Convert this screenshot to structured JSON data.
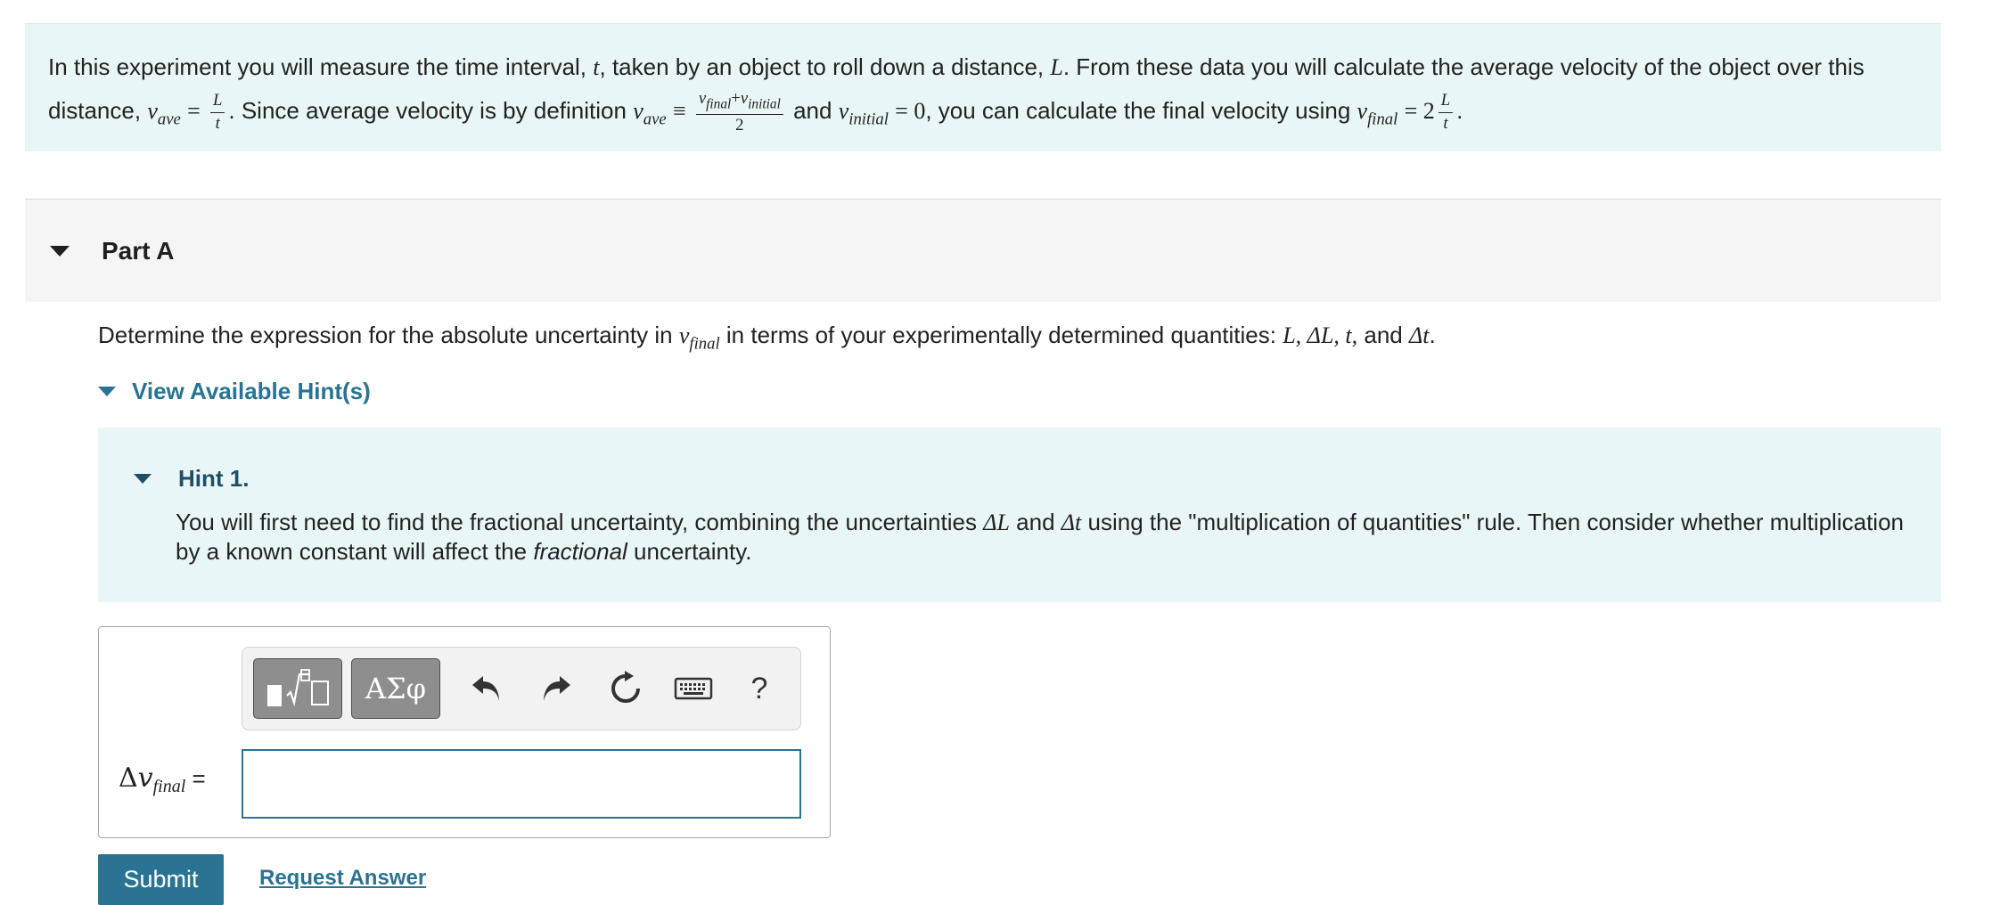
{
  "intro": {
    "s1": "In this experiment you will measure the time interval,",
    "var_t": "t",
    "s2": ", taken by an object to roll down a distance,",
    "var_L": "L",
    "s3": ". From these data you will calculate the average velocity of the object over this",
    "s4": "distance,",
    "v": "v",
    "sub_ave": "ave",
    "eq": "=",
    "s5": ". Since average velocity is by definition",
    "equiv": "≡",
    "sub_final": "final",
    "plus": "+",
    "sub_initial": "initial",
    "two": "2",
    "s6": "and",
    "zero": "= 0",
    "s7": ", you can calculate the final velocity using",
    "eq2": "= 2",
    "period": "."
  },
  "part": {
    "title": "Part A"
  },
  "question": {
    "s1": "Determine the expression for the absolute uncertainty in",
    "v": "v",
    "sub_final": "final",
    "s2": "in terms of your experimentally determined quantities:",
    "quantities": "L, ΔL, t,",
    "s3": "and",
    "dt": "Δt",
    "period": "."
  },
  "hints": {
    "toggle_label": "View Available Hint(s)",
    "hint1": {
      "title": "Hint 1.",
      "s1": "You will first need to find the fractional uncertainty, combining the uncertainties",
      "dL": "ΔL",
      "and": "and",
      "dt": "Δt",
      "s2": "using the \"multiplication of quantities\" rule. Then consider whether multiplication by a known constant will affect the",
      "emph": "fractional",
      "s3": "uncertainty."
    }
  },
  "answer": {
    "toolbar": {
      "greek_label": "ΑΣφ",
      "help_label": "?",
      "icons": [
        "templates-icon",
        "undo-icon",
        "redo-icon",
        "reset-icon",
        "keyboard-icon"
      ]
    },
    "label_delta": "Δ",
    "label_v": "v",
    "label_sub": "final",
    "label_eq": "=",
    "input_value": ""
  },
  "actions": {
    "submit_label": "Submit",
    "request_label": "Request Answer"
  },
  "colors": {
    "accent": "#2a7393",
    "hint_bg": "#e9f6f7",
    "part_bg": "#f5f5f5"
  }
}
